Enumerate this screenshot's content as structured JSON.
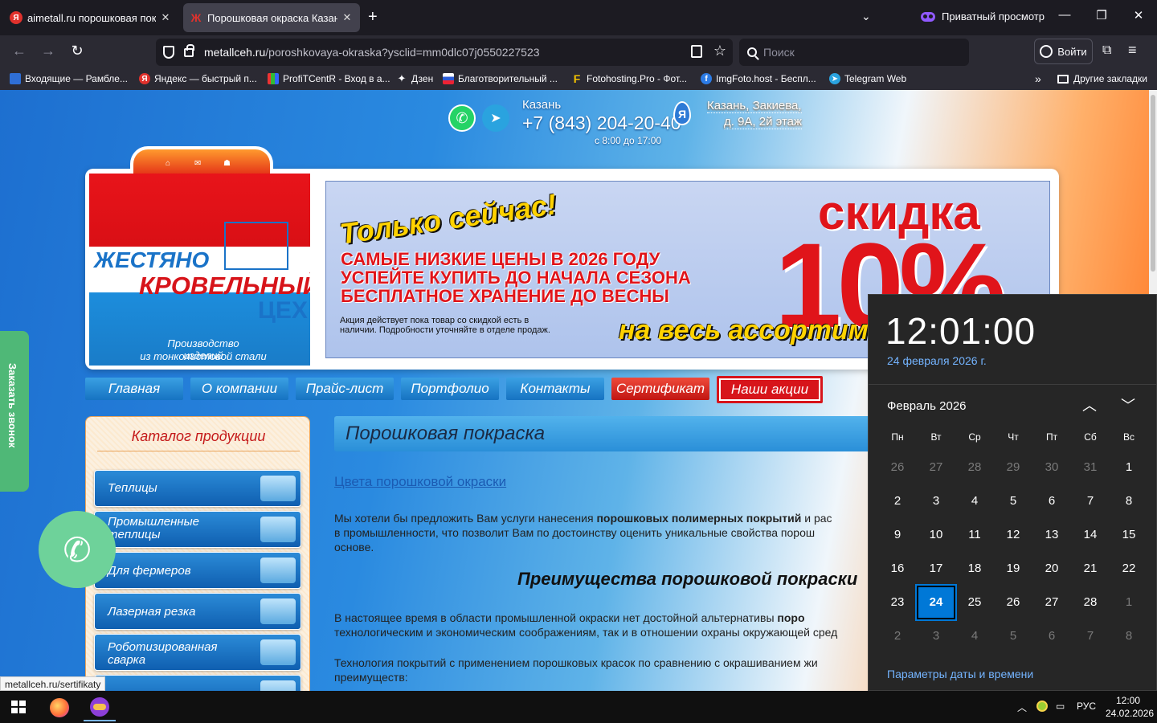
{
  "browser": {
    "tabs": [
      {
        "label": "aimetall.ru порошковая покраска",
        "icon": "yandex-icon",
        "active": false
      },
      {
        "label": "Порошковая окраска Казань. ...",
        "icon": "zh-favicon-icon",
        "active": true
      }
    ],
    "private_label": "Приватный просмотр",
    "url_domain": "metallceh.ru",
    "url_path": "/poroshkovaya-okraska?ysclid=mm0dlc07j0550227523",
    "search_placeholder": "Поиск",
    "login_label": "Войти",
    "bookmarks": [
      {
        "label": "Входящие — Рамбле...",
        "icon": "mail-icon"
      },
      {
        "label": "Яндекс — быстрый п...",
        "icon": "yandex-icon"
      },
      {
        "label": "ProfiTCentR - Вход в а...",
        "icon": "chart-icon"
      },
      {
        "label": "Дзен",
        "icon": "zen-icon"
      },
      {
        "label": "Благотворительный ...",
        "icon": "flag-icon"
      },
      {
        "label": "Fotohosting.Pro - Фот...",
        "icon": "f-icon"
      },
      {
        "label": "ImgFoto.host - Беспл...",
        "icon": "imgfoto-icon"
      },
      {
        "label": "Telegram Web",
        "icon": "telegram-icon"
      }
    ],
    "other_bookmarks": "Другие закладки"
  },
  "site": {
    "city": "Казань",
    "phone": "+7 (843) 204-20-40",
    "hours": "с 8:00 до 17:00",
    "address_line1": "Казань, Закиева,",
    "address_line2": "д. 9А, 2й этаж",
    "logo": {
      "line1": "ЖЕСТЯНО",
      "line2": "КРОВЕЛЬНЫЙ",
      "line3": "ЦЕХ",
      "tagline1": "Производство изделий",
      "tagline2": "из тонколистовой стали"
    },
    "banner": {
      "headline": "Только сейчас!",
      "line1": "САМЫЕ НИЗКИЕ ЦЕНЫ В 2026 ГОДУ",
      "line2": "УСПЕЙТЕ КУПИТЬ ДО НАЧАЛА СЕЗОНА",
      "line3": "БЕСПЛАТНОЕ ХРАНЕНИЕ ДО ВЕСНЫ",
      "small": "Акция действует пока товар со скидкой есть в наличии. Подробности уточняйте в отделе продаж.",
      "discount_word": "скидка",
      "discount_value": "10%",
      "bottom": "на весь ассортимент"
    },
    "menu": [
      "Главная",
      "О компании",
      "Прайс-лист",
      "Портфолио",
      "Контакты",
      "Сертификат",
      "Наши акции"
    ],
    "catalog_title": "Каталог продукции",
    "catalog": [
      "Теплицы",
      "Промышленные теплицы",
      "Для фермеров",
      "Лазерная резка",
      "Роботизированная сварка"
    ],
    "page_title": "Порошковая покраска",
    "colors_link": "Цвета порошковой окраски",
    "para1_a": "Мы хотели бы предложить Вам услуги нанесения ",
    "para1_b": "порошковых полимерных покрытий",
    "para1_c": " и рас",
    "para1_line2": "в промышленности, что позволит Вам по достоинству оценить уникальные свойства порош",
    "para1_line3": "основе.",
    "h2": "Преимущества порошковой покраски",
    "para2_a": "В настоящее время в области промышленной окраски нет достойной альтернативы ",
    "para2_b": "поро",
    "para2_line2": "технологическим и экономическим соображениям, так и в отношении охраны окружающей сред",
    "para3_line1": "Технология покрытий с применением порошковых красок по сравнению с окрашиванием жи",
    "para3_line2": "преимуществ:",
    "callback": "Заказать звонок",
    "status_url": "metallceh.ru/sertifikaty"
  },
  "calendar": {
    "time": "12:01:00",
    "date_long": "24 февраля 2026 г.",
    "month_label": "Февраль 2026",
    "weekdays": [
      "Пн",
      "Вт",
      "Ср",
      "Чт",
      "Пт",
      "Сб",
      "Вс"
    ],
    "weeks": [
      [
        "26",
        "27",
        "28",
        "29",
        "30",
        "31",
        "1"
      ],
      [
        "2",
        "3",
        "4",
        "5",
        "6",
        "7",
        "8"
      ],
      [
        "9",
        "10",
        "11",
        "12",
        "13",
        "14",
        "15"
      ],
      [
        "16",
        "17",
        "18",
        "19",
        "20",
        "21",
        "22"
      ],
      [
        "23",
        "24",
        "25",
        "26",
        "27",
        "28",
        "1"
      ],
      [
        "2",
        "3",
        "4",
        "5",
        "6",
        "7",
        "8"
      ]
    ],
    "today": "24",
    "settings_link": "Параметры даты и времени"
  },
  "taskbar": {
    "lang": "РУС",
    "time": "12:00",
    "date": "24.02.2026"
  }
}
